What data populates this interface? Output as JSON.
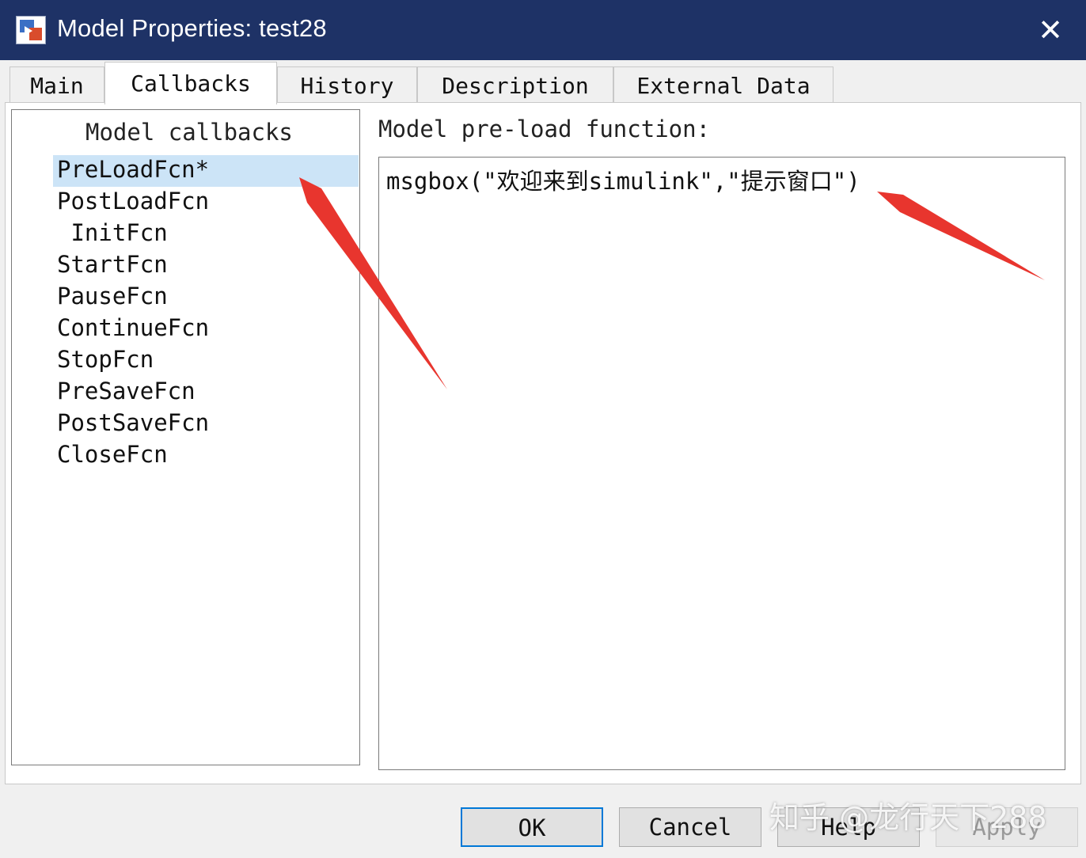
{
  "window": {
    "title": "Model Properties: test28",
    "close_glyph": "✕"
  },
  "tabs": [
    {
      "label": "Main"
    },
    {
      "label": "Callbacks",
      "active": true
    },
    {
      "label": "History"
    },
    {
      "label": "Description"
    },
    {
      "label": "External Data"
    }
  ],
  "callbacks": {
    "header": "Model callbacks",
    "selected": "PreLoadFcn*",
    "items": [
      {
        "label": "PreLoadFcn*"
      },
      {
        "label": "PostLoadFcn"
      },
      {
        "label": " InitFcn"
      },
      {
        "label": "StartFcn"
      },
      {
        "label": "PauseFcn"
      },
      {
        "label": "ContinueFcn"
      },
      {
        "label": "StopFcn"
      },
      {
        "label": "PreSaveFcn"
      },
      {
        "label": "PostSaveFcn"
      },
      {
        "label": "CloseFcn"
      }
    ]
  },
  "editor": {
    "label": "Model pre-load function:",
    "code": "msgbox(\"欢迎来到simulink\",\"提示窗口\")"
  },
  "buttons": {
    "ok": "OK",
    "cancel": "Cancel",
    "help": "Help",
    "apply": "Apply"
  },
  "watermark": "知乎 @龙行天下288",
  "colors": {
    "titlebar": "#1e3266",
    "selection": "#cce4f7",
    "default_button_border": "#0078d7",
    "annotation_arrow": "#e8352e"
  }
}
